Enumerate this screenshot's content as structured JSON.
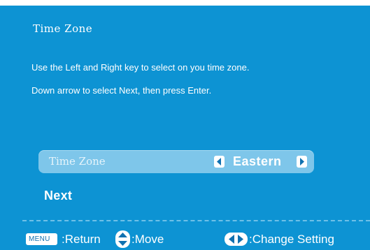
{
  "dialog": {
    "title": "Time Zone",
    "instruction_line1": "Use the Left and Right key to select on you time zone.",
    "instruction_line2": "Down arrow to select Next, then press Enter."
  },
  "time_zone_row": {
    "label": "Time Zone",
    "value": "Eastern"
  },
  "next_label": "Next",
  "footer": {
    "menu_key": "MENU",
    "return_label": ":Return",
    "move_label": ":Move",
    "change_label": ":Change Setting"
  },
  "colors": {
    "background": "#0d93d3",
    "row_highlight": "#7ec6ea",
    "text": "#ffffff"
  },
  "icons": [
    "left-arrow-icon",
    "right-arrow-icon",
    "menu-key-icon",
    "up-down-move-icon",
    "left-right-change-icon"
  ]
}
